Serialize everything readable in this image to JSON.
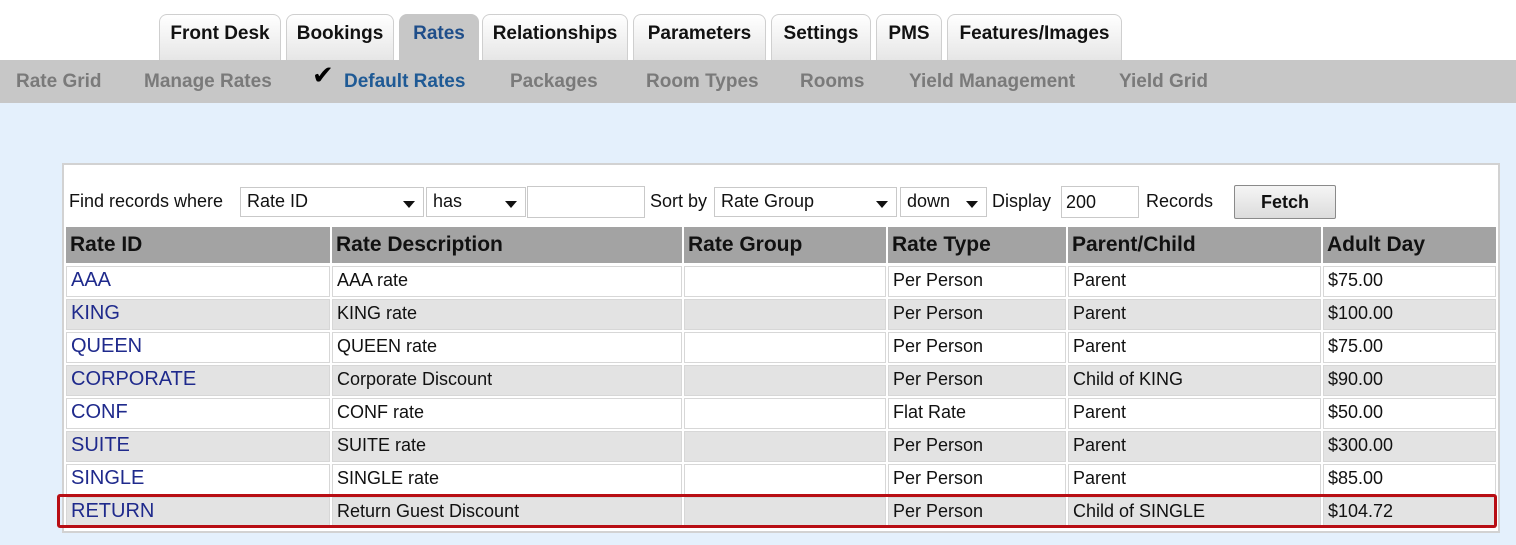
{
  "tabs": [
    {
      "label": "Front Desk",
      "active": false
    },
    {
      "label": "Bookings",
      "active": false
    },
    {
      "label": "Rates",
      "active": true
    },
    {
      "label": "Relationships",
      "active": false
    },
    {
      "label": "Parameters",
      "active": false
    },
    {
      "label": "Settings",
      "active": false
    },
    {
      "label": "PMS",
      "active": false
    },
    {
      "label": "Features/Images",
      "active": false
    }
  ],
  "subnav": [
    {
      "label": "Rate Grid",
      "active": false
    },
    {
      "label": "Manage Rates",
      "active": false
    },
    {
      "label": "Default Rates",
      "active": true
    },
    {
      "label": "Packages",
      "active": false
    },
    {
      "label": "Room Types",
      "active": false
    },
    {
      "label": "Rooms",
      "active": false
    },
    {
      "label": "Yield Management",
      "active": false
    },
    {
      "label": "Yield Grid",
      "active": false
    }
  ],
  "filter": {
    "find_label": "Find records where",
    "field": "Rate ID",
    "operator": "has",
    "value": "",
    "sort_label": "Sort by",
    "sort_field": "Rate Group",
    "sort_dir": "down",
    "display_label": "Display",
    "display_count": "200",
    "records_label": "Records",
    "fetch_label": "Fetch"
  },
  "table": {
    "headers": [
      "Rate ID",
      "Rate Description",
      "Rate Group",
      "Rate Type",
      "Parent/Child",
      "Adult Day"
    ],
    "rows": [
      [
        "AAA",
        "AAA rate",
        "",
        "Per Person",
        "Parent",
        "$75.00"
      ],
      [
        "KING",
        "KING rate",
        "",
        "Per Person",
        "Parent",
        "$100.00"
      ],
      [
        "QUEEN",
        "QUEEN rate",
        "",
        "Per Person",
        "Parent",
        "$75.00"
      ],
      [
        "CORPORATE",
        "Corporate Discount",
        "",
        "Per Person",
        "Child of KING",
        "$90.00"
      ],
      [
        "CONF",
        "CONF rate",
        "",
        "Flat Rate",
        "Parent",
        "$50.00"
      ],
      [
        "SUITE",
        "SUITE rate",
        "",
        "Per Person",
        "Parent",
        "$300.00"
      ],
      [
        "SINGLE",
        "SINGLE rate",
        "",
        "Per Person",
        "Parent",
        "$85.00"
      ],
      [
        "RETURN",
        "Return Guest Discount",
        "",
        "Per Person",
        "Child of SINGLE",
        "$104.72"
      ]
    ],
    "highlighted_row": 7
  },
  "colors": {
    "accent": "#1f5a95",
    "highlight": "#b80e14",
    "link": "#1f2a8c"
  }
}
